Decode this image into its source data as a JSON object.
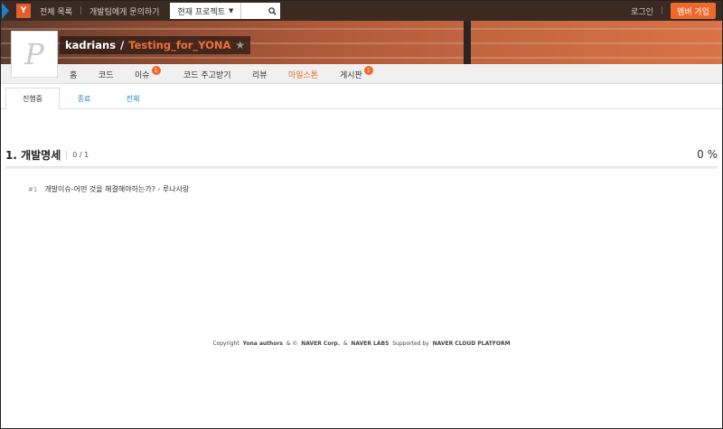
{
  "topbar": {
    "logo_letter": "Y",
    "all_projects": "전체 목록",
    "contact": "개발팀에게 문의하기",
    "project_select": "현재 프로젝트",
    "login": "로그인",
    "signup": "멤버 가입"
  },
  "project": {
    "owner": "kadrians",
    "separator": "/",
    "name": "Testing_for_YONA",
    "avatar_letter": "P"
  },
  "nav": {
    "items": [
      {
        "label": "홈"
      },
      {
        "label": "코드"
      },
      {
        "label": "이슈",
        "badge": "1"
      },
      {
        "label": "코드 주고받기"
      },
      {
        "label": "리뷰"
      },
      {
        "label": "마일스톤",
        "active": true
      },
      {
        "label": "게시판",
        "badge": "1"
      }
    ]
  },
  "tabs": [
    {
      "label": "진행중",
      "active": true
    },
    {
      "label": "종료"
    },
    {
      "label": "전체"
    }
  ],
  "milestone": {
    "title": "1. 개발명세",
    "count": "0 / 1",
    "percent": "0 %",
    "progress": 0,
    "issues": [
      {
        "number": "#1",
        "title": "개발이슈-어떤 것을 해결해야하는가? - 루나사랑"
      }
    ]
  },
  "footer": {
    "copyright": "Copyright",
    "authors": "Yona authors",
    "amp1": "& ©",
    "naver": "NAVER Corp.",
    "amp2": "&",
    "labs": "NAVER LABS",
    "supported": "Supported by",
    "cloud": "NAVER CLOUD PLATFORM"
  },
  "colors": {
    "accent": "#ef6a2a",
    "link": "#1f7fc8",
    "topbar": "#3a2a22"
  }
}
